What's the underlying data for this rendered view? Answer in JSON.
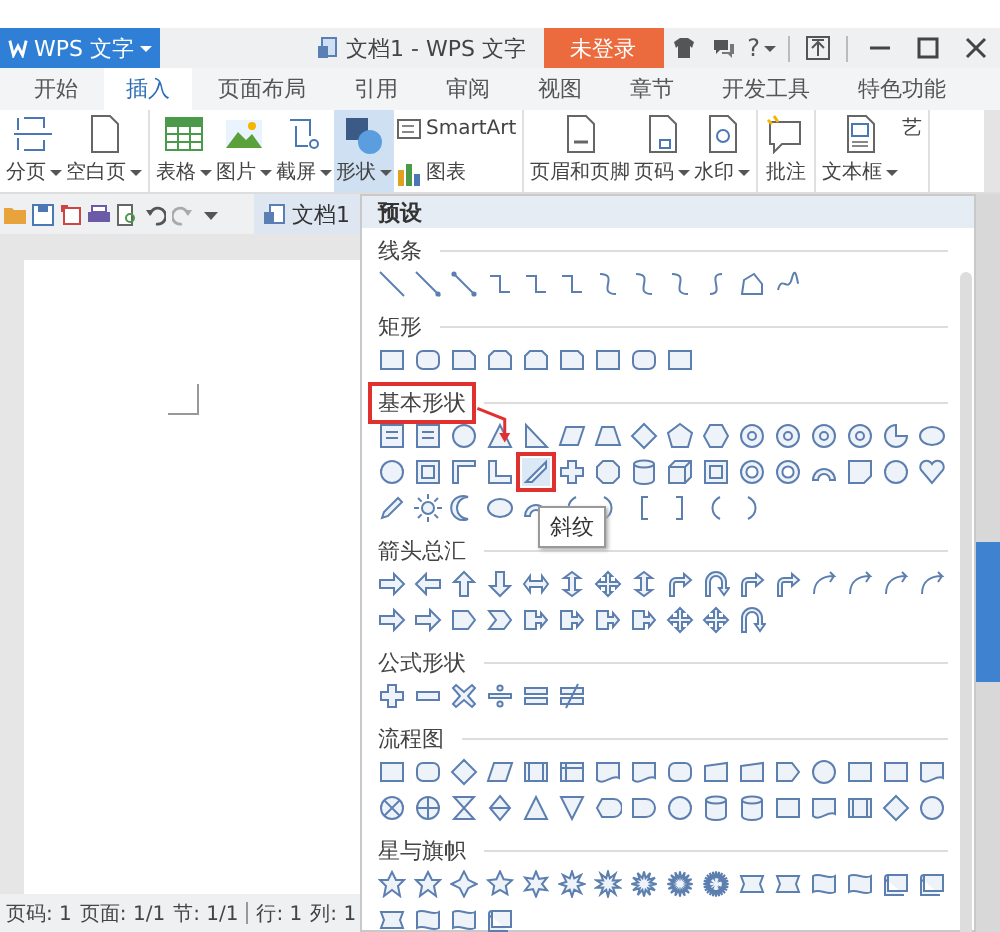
{
  "app_menu": {
    "label": "WPS 文字",
    "dropdown": true
  },
  "window": {
    "title": "文档1 - WPS 文字"
  },
  "login_button": {
    "label": "未登录"
  },
  "help": {
    "label": "?",
    "dropdown": true
  },
  "tabs": [
    {
      "label": "开始",
      "selected": false
    },
    {
      "label": "插入",
      "selected": true
    },
    {
      "label": "页面布局",
      "selected": false
    },
    {
      "label": "引用",
      "selected": false
    },
    {
      "label": "审阅",
      "selected": false
    },
    {
      "label": "视图",
      "selected": false
    },
    {
      "label": "章节",
      "selected": false
    },
    {
      "label": "开发工具",
      "selected": false
    },
    {
      "label": "特色功能",
      "selected": false
    }
  ],
  "ribbon": {
    "groups": [
      {
        "items": [
          {
            "kind": "large",
            "label": "分页",
            "dropdown": true,
            "active": false
          },
          {
            "kind": "large",
            "label": "空白页",
            "dropdown": true,
            "active": false
          }
        ]
      },
      {
        "items": [
          {
            "kind": "large",
            "label": "表格",
            "dropdown": true,
            "active": false
          },
          {
            "kind": "large",
            "label": "图片",
            "dropdown": true,
            "active": false
          },
          {
            "kind": "large",
            "label": "截屏",
            "dropdown": true,
            "active": false
          },
          {
            "kind": "large",
            "label": "形状",
            "dropdown": true,
            "active": true
          },
          {
            "kind": "small",
            "label": "SmartArt",
            "dropdown": false,
            "active": false
          },
          {
            "kind": "small",
            "label": "图表",
            "dropdown": false,
            "active": false
          }
        ]
      },
      {
        "items": [
          {
            "kind": "large",
            "label": "页眉和页脚",
            "dropdown": false,
            "active": false
          },
          {
            "kind": "large",
            "label": "页码",
            "dropdown": true,
            "active": false
          },
          {
            "kind": "large",
            "label": "水印",
            "dropdown": true,
            "active": false
          }
        ]
      },
      {
        "items": [
          {
            "kind": "large",
            "label": "批注",
            "dropdown": false,
            "active": false
          }
        ]
      },
      {
        "items": [
          {
            "kind": "large",
            "label": "文本框",
            "dropdown": true,
            "active": false
          },
          {
            "kind": "large",
            "label": "艺",
            "dropdown": false,
            "active": false
          }
        ]
      }
    ]
  },
  "document_tab": {
    "label": "文档1"
  },
  "shape_panel": {
    "header": "预设",
    "tooltip": "斜纹",
    "sections": [
      {
        "title": "线条",
        "highlighted": false
      },
      {
        "title": "矩形",
        "highlighted": false
      },
      {
        "title": "基本形状",
        "highlighted": true
      },
      {
        "title": "箭头总汇",
        "highlighted": false
      },
      {
        "title": "公式形状",
        "highlighted": false
      },
      {
        "title": "流程图",
        "highlighted": false
      },
      {
        "title": "星与旗帜",
        "highlighted": false
      }
    ]
  },
  "status_bar": [
    {
      "label": "页码: 1",
      "divider": false
    },
    {
      "label": "页面: 1/1",
      "divider": false
    },
    {
      "label": "节: 1/1",
      "divider": true
    },
    {
      "label": "行: 1",
      "divider": false
    },
    {
      "label": "列: 1",
      "divider": false
    }
  ]
}
